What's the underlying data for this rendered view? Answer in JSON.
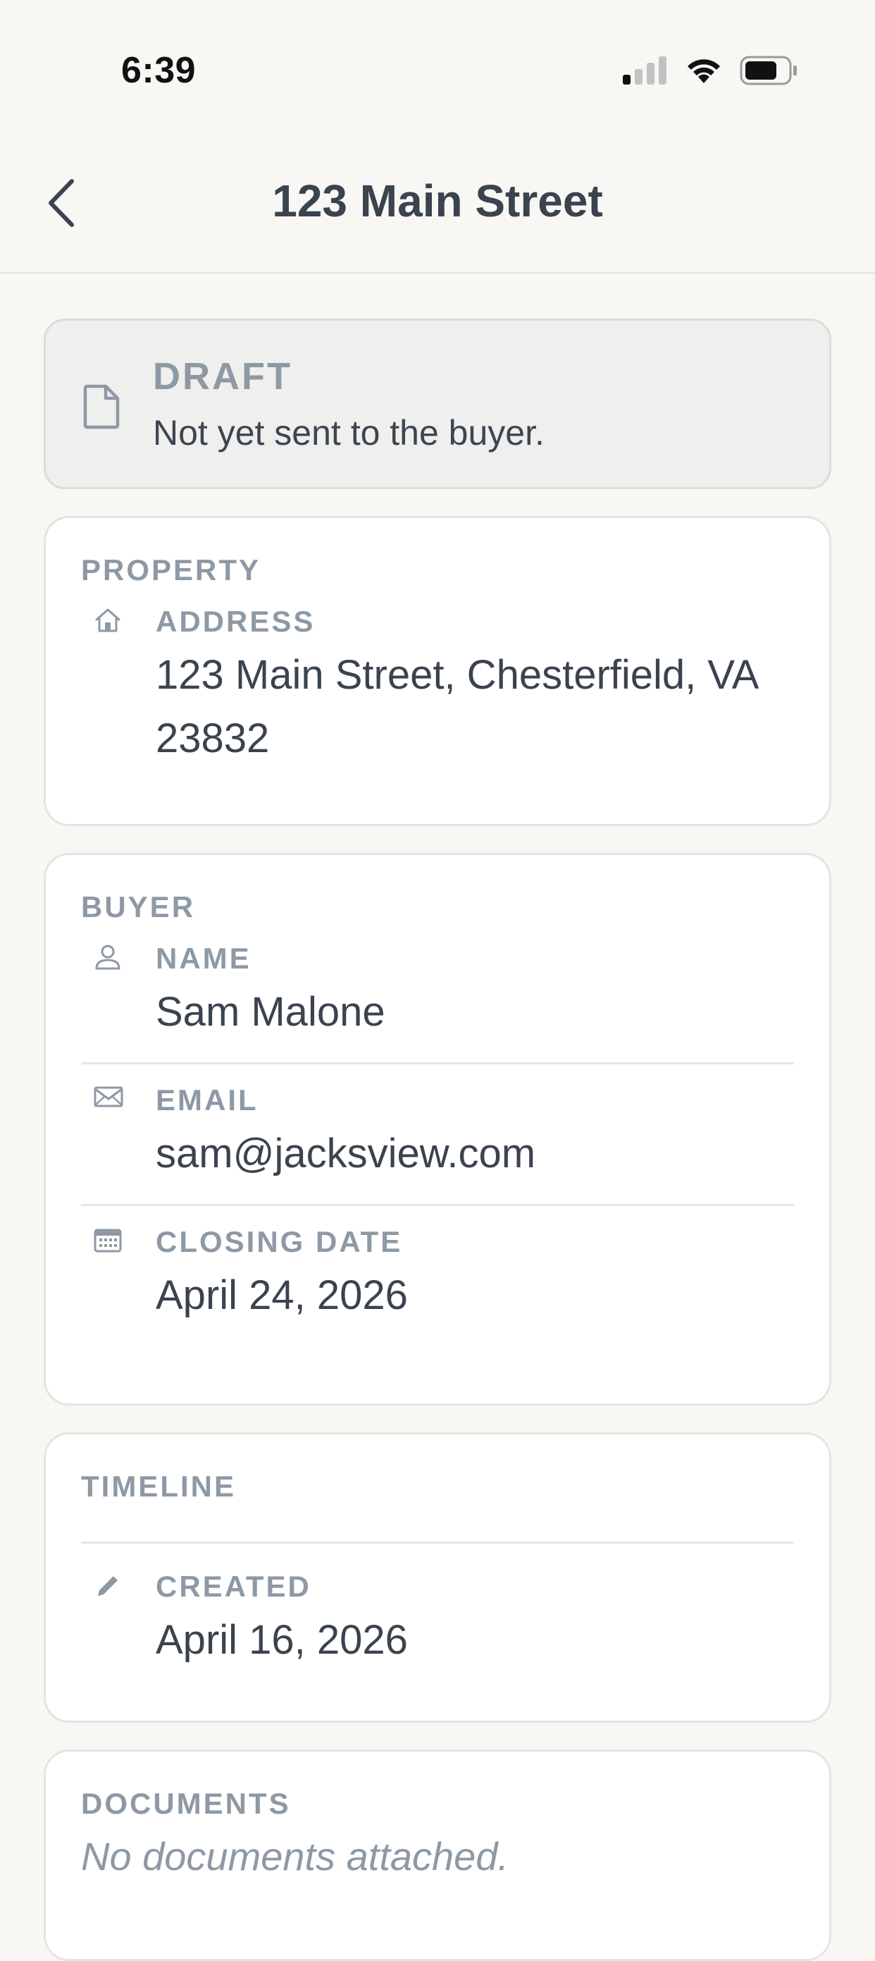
{
  "status_bar": {
    "time": "6:39",
    "icons": [
      "cellular-signal-icon",
      "wifi-icon",
      "battery-icon"
    ]
  },
  "nav": {
    "title": "123 Main Street",
    "back_icon": "chevron-left-icon"
  },
  "status_banner": {
    "title": "DRAFT",
    "subtitle": "Not yet sent to the buyer.",
    "icon": "document-icon"
  },
  "property": {
    "title": "PROPERTY",
    "address_label": "ADDRESS",
    "address_value": "123 Main Street, Chesterfield, VA 23832"
  },
  "buyer": {
    "title": "BUYER",
    "name_label": "NAME",
    "name_value": "Sam Malone",
    "email_label": "EMAIL",
    "email_value": "sam@jacksview.com",
    "closing_label": "CLOSING DATE",
    "closing_value": "April 24, 2026"
  },
  "timeline": {
    "title": "TIMELINE",
    "created_label": "CREATED",
    "created_value": "April 16, 2026"
  },
  "documents": {
    "title": "DOCUMENTS",
    "empty_text": "No documents attached."
  },
  "colors": {
    "background": "#f8f7f4",
    "card": "#ffffff",
    "muted": "#8d99a5",
    "text": "#3a434e",
    "banner_bg": "#efefee"
  }
}
